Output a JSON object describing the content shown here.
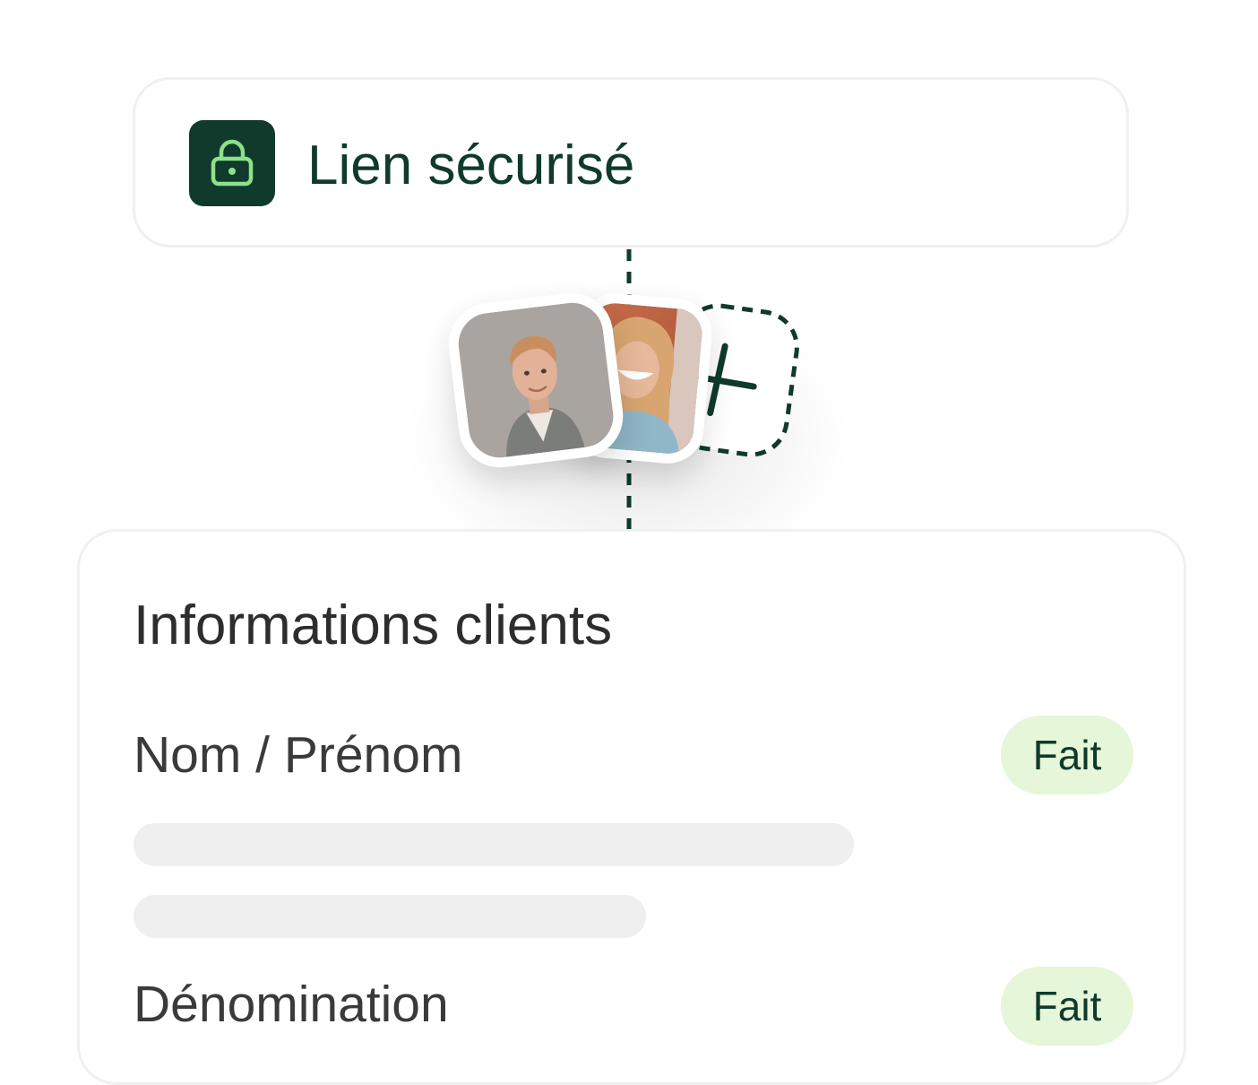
{
  "secure_link": {
    "icon": "lock-icon",
    "label": "Lien sécurisé"
  },
  "collaborators": {
    "avatars": [
      "avatar-man",
      "avatar-woman"
    ],
    "add_icon": "plus-icon"
  },
  "client_info": {
    "title": "Informations clients",
    "fields": [
      {
        "label": "Nom / Prénom",
        "status": "Fait"
      },
      {
        "label": "Dénomination",
        "status": "Fait"
      }
    ]
  },
  "colors": {
    "brand_dark": "#0f3a2c",
    "lock_icon": "#8fe08a",
    "badge_bg": "#e6f6d8",
    "skeleton": "#efefef",
    "card_border": "#f0f0f0"
  }
}
